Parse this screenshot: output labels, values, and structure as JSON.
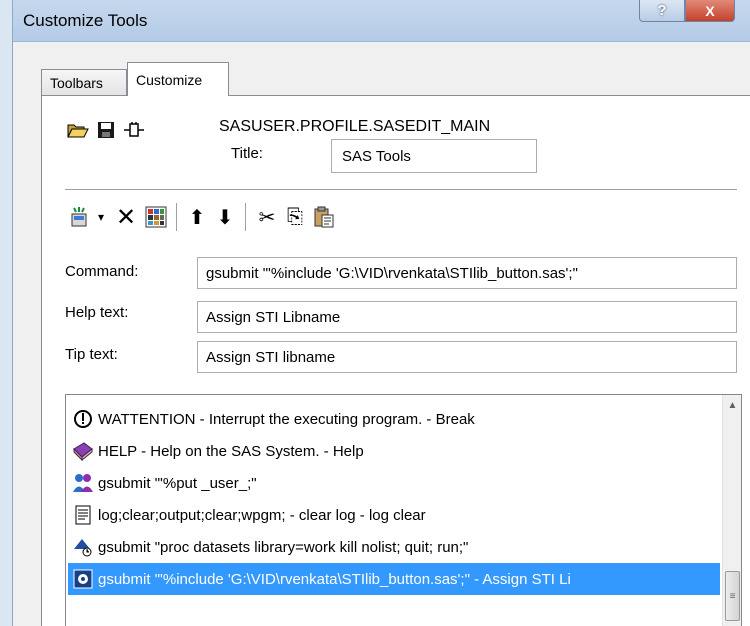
{
  "window": {
    "title": "Customize Tools",
    "help_glyph": "?",
    "close_glyph": "X"
  },
  "tabs": [
    {
      "label": "Toolbars",
      "active": false
    },
    {
      "label": "Customize",
      "active": true
    }
  ],
  "header": {
    "path": "SASUSER.PROFILE.SASEDIT_MAIN",
    "title_label": "Title:",
    "title_value": "SAS Tools",
    "icons": [
      "open-folder-icon",
      "save-disk-icon",
      "connector-icon"
    ]
  },
  "toolbar": {
    "glyphs": {
      "add": "✦",
      "dropdown": "▾",
      "delete": "✕",
      "icons_grid": "▦",
      "up": "⬆",
      "down": "⬇",
      "cut": "✂",
      "copy": "⎘",
      "paste": "📋"
    }
  },
  "fields": {
    "command_label": "Command:",
    "command_value": "gsubmit \"'%include 'G:\\VID\\rvenkata\\STIlib_button.sas';\"",
    "help_label": "Help text:",
    "help_value": "Assign STI Libname",
    "tip_label": "Tip text:",
    "tip_value": "Assign STI libname"
  },
  "list": {
    "items": [
      {
        "icon": "attention-icon",
        "text": "WATTENTION - Interrupt the executing program. - Break",
        "selected": false
      },
      {
        "icon": "help-book-icon",
        "text": "HELP - Help on the SAS System. - Help",
        "selected": false
      },
      {
        "icon": "users-icon",
        "text": "gsubmit \"'%put _user_;\"",
        "selected": false
      },
      {
        "icon": "log-clear-icon",
        "text": "log;clear;output;clear;wpgm; - clear log - log clear",
        "selected": false
      },
      {
        "icon": "datasets-icon",
        "text": "gsubmit \"proc datasets library=work kill nolist; quit; run;\"",
        "selected": false
      },
      {
        "icon": "library-icon",
        "text": "gsubmit \"'%include 'G:\\VID\\rvenkata\\STIlib_button.sas';\" - Assign STI Li",
        "selected": true
      }
    ],
    "scroll_up_glyph": "▲",
    "scroll_thumb_glyph": "≡"
  },
  "colors": {
    "selection": "#3399ff",
    "titlebar": "#c6d8ee",
    "close_button": "#c4412b"
  }
}
